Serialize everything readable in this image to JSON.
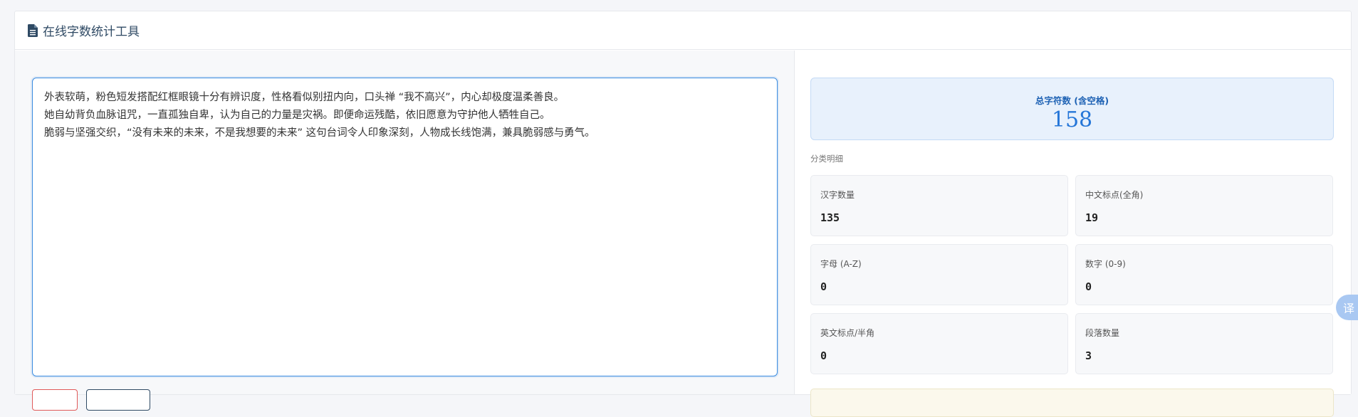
{
  "app": {
    "title": "在线字数统计工具",
    "icon": "file-text-icon"
  },
  "editor": {
    "lines": [
      "外表软萌，粉色短发搭配红框眼镜十分有辨识度，性格看似别扭内向，口头禅 “我不高兴”，内心却极度温柔善良。",
      "她自幼背负血脉诅咒，一直孤独自卑，认为自己的力量是灾祸。即便命运残酷，依旧愿意为守护他人牺牲自己。",
      "脆弱与坚强交织，“没有未来的未来，不是我想要的未来” 这句台词令人印象深刻，人物成长线饱满，兼具脆弱感与勇气。"
    ]
  },
  "summary": {
    "total_label": "总字符数 (含空格)",
    "total_value": "158",
    "section_label": "分类明细"
  },
  "stats": [
    {
      "label": "汉字数量",
      "value": "135"
    },
    {
      "label": "中文标点(全角)",
      "value": "19"
    },
    {
      "label": "字母 (A-Z)",
      "value": "0"
    },
    {
      "label": "数字 (0-9)",
      "value": "0"
    },
    {
      "label": "英文标点/半角",
      "value": "0"
    },
    {
      "label": "段落数量",
      "value": "3"
    }
  ],
  "floating": {
    "translate_label": "译"
  },
  "colors": {
    "accent": "#2576d8",
    "title": "#2f4a64",
    "danger": "#e05a5a"
  }
}
